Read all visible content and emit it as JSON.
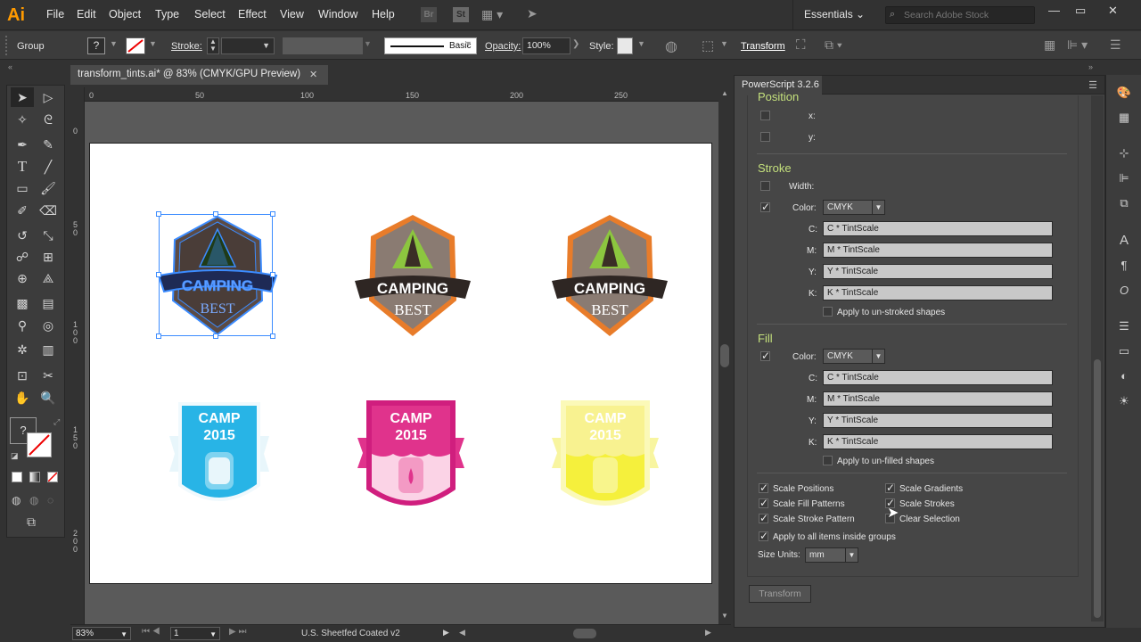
{
  "app": {
    "logo": "Ai",
    "menu": [
      "File",
      "Edit",
      "Object",
      "Type",
      "Select",
      "Effect",
      "View",
      "Window",
      "Help"
    ],
    "bridge": "Br",
    "stock": "St",
    "workspace": "Essentials",
    "search_placeholder": "Search Adobe Stock"
  },
  "control": {
    "selection": "Group",
    "stroke_label": "Stroke:",
    "brush": "Basic",
    "opacity_label": "Opacity:",
    "opacity_value": "100%",
    "style_label": "Style:",
    "transform_link": "Transform"
  },
  "document": {
    "tab_title": "transform_tints.ai* @ 83% (CMYK/GPU Preview)"
  },
  "ruler": {
    "top": [
      "0",
      "50",
      "100",
      "150",
      "200",
      "250"
    ],
    "left": [
      "0",
      "5 0",
      "1 0 0",
      "1 5 0",
      "2 0 0"
    ]
  },
  "status": {
    "zoom": "83%",
    "artboard": "1",
    "profile": "U.S. Sheetfed Coated v2"
  },
  "badges": {
    "camping": "CAMPING",
    "best": "BEST",
    "camp": "CAMP",
    "year": "2015"
  },
  "panel": {
    "tab": "PowerScript 3.2.6",
    "position": {
      "title": "Position",
      "x": "x:",
      "y": "y:"
    },
    "stroke": {
      "title": "Stroke",
      "width_label": "Width:",
      "color_label": "Color:",
      "color_mode": "CMYK",
      "channels": [
        {
          "label": "C:",
          "value": "C * TintScale"
        },
        {
          "label": "M:",
          "value": "M * TintScale"
        },
        {
          "label": "Y:",
          "value": "Y * TintScale"
        },
        {
          "label": "K:",
          "value": "K * TintScale"
        }
      ],
      "apply_label": "Apply to un-stroked shapes"
    },
    "fill": {
      "title": "Fill",
      "color_label": "Color:",
      "color_mode": "CMYK",
      "channels": [
        {
          "label": "C:",
          "value": "C * TintScale"
        },
        {
          "label": "M:",
          "value": "M * TintScale"
        },
        {
          "label": "Y:",
          "value": "Y * TintScale"
        },
        {
          "label": "K:",
          "value": "K * TintScale"
        }
      ],
      "apply_label": "Apply to un-filled shapes"
    },
    "options": {
      "scale_positions": "Scale Positions",
      "scale_gradients": "Scale Gradients",
      "scale_fill_patterns": "Scale Fill Patterns",
      "scale_strokes": "Scale Strokes",
      "scale_stroke_pattern": "Scale Stroke Pattern",
      "clear_selection": "Clear Selection",
      "apply_groups": "Apply to all items inside groups",
      "size_units_label": "Size Units:",
      "size_units_value": "mm"
    },
    "transform_button": "Transform"
  },
  "colors": {
    "accent_section": "#c4e07c",
    "selection_blue": "#3c8cff",
    "magenta": "#e0338c",
    "cyan": "#28b4e6",
    "yellow": "#f5f03c"
  }
}
